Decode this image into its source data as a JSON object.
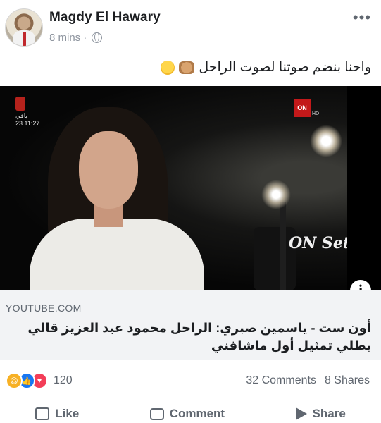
{
  "post": {
    "author": "Magdy El Hawary",
    "time": "8 mins",
    "separator": "·",
    "text": "واحنا بنضم صوتنا لصوت الراحل",
    "more_icon": "more-horizontal-icon",
    "privacy_icon": "globe-icon"
  },
  "video": {
    "channel_label": "باقي",
    "channel_time": "23 11:27",
    "on_logo": "ON",
    "on_hd": "HD",
    "show_logo": "ON Set",
    "info_label": "i"
  },
  "link": {
    "domain": "YOUTUBE.COM",
    "title": "أون ست - ياسمين صبري: الراحل محمود عبد العزيز قالي بطلي تمثيل أول ماشافني"
  },
  "stats": {
    "reaction_count": "120",
    "comments": "32 Comments",
    "shares": "8 Shares"
  },
  "actions": {
    "like": "Like",
    "comment": "Comment",
    "share": "Share"
  },
  "colors": {
    "secondary_text": "#606770",
    "like_blue": "#1877f2",
    "love_red": "#f33e58",
    "haha_yellow": "#f7b125"
  }
}
